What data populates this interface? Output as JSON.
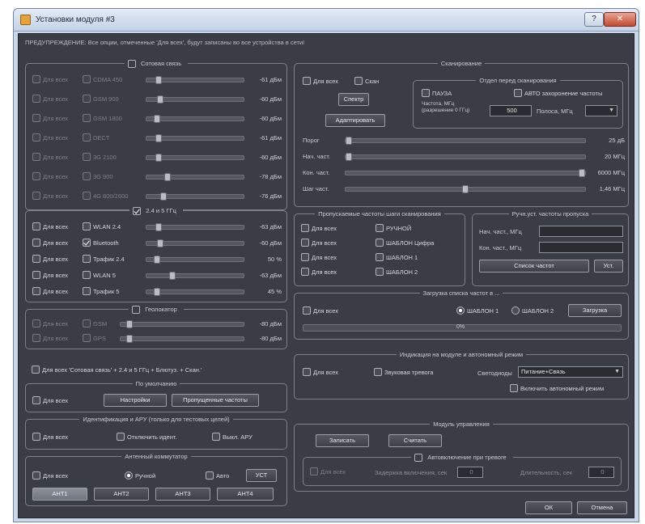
{
  "window": {
    "title": "Установки модуля #3"
  },
  "warning": "ПРЕДУПРЕЖДЕНИЕ: Все опции, отмеченные 'Для всех', будут записаны во все устройства в сети!",
  "common": {
    "for_all": "Для всех"
  },
  "cellular": {
    "title": "Сотовая связь",
    "rows": [
      {
        "name": "CDMA 450",
        "value": "-61 дБм",
        "level": 0.1
      },
      {
        "name": "GSM 900",
        "value": "-60 дБм",
        "level": 0.12
      },
      {
        "name": "GSM 1800",
        "value": "-60 дБм",
        "level": 0.08
      },
      {
        "name": "DECT",
        "value": "-61 дБм",
        "level": 0.1
      },
      {
        "name": "3G 2100",
        "value": "-60 дБм",
        "level": 0.1
      },
      {
        "name": "3G 900",
        "value": "-78 дБм",
        "level": 0.2
      },
      {
        "name": "4G 800/2600",
        "value": "-76 дБм",
        "level": 0.15
      }
    ]
  },
  "ghz": {
    "title": "2.4 и 5 ГГц",
    "rows": [
      {
        "name": "WLAN 2.4",
        "value": "-63 дБм",
        "level": 0.1,
        "checked": false
      },
      {
        "name": "Bluetooth",
        "value": "-60 дБм",
        "level": 0.12,
        "checked": true
      },
      {
        "name": "Трафик 2.4",
        "value": "50 %",
        "level": 0.08,
        "checked": false
      },
      {
        "name": "WLAN 5",
        "value": "-63 дБм",
        "level": 0.25,
        "checked": false
      },
      {
        "name": "Трафик 5",
        "value": "45 %",
        "level": 0.08,
        "checked": false
      }
    ]
  },
  "gps": {
    "title": "Геолокатор",
    "rows": [
      {
        "name": "GSM",
        "value": "-80 дБм",
        "level": 0.05
      },
      {
        "name": "GPS",
        "value": "-80 дБм",
        "level": 0.05
      }
    ]
  },
  "forall_long": "Для всех 'Сотовая связь' + 2.4 и 5 ГГц + Блютуз. + Скан.'",
  "defaults": {
    "title": "По умолчанию",
    "settings_btn": "Настройки",
    "freq_btn": "Пропущенные частоты"
  },
  "identify": {
    "title": "Идентификация и АРУ (только для тестовых целей)",
    "mute": "Отключить идент.",
    "vykl": "Выкл. АРУ"
  },
  "antenna": {
    "title": "Антенный коммутатор",
    "manual": "Ручной",
    "auto": "Авто",
    "set": "УСТ",
    "tabs": [
      "АНТ1",
      "АНТ2",
      "АНТ3",
      "АНТ4"
    ]
  },
  "scan": {
    "title": "Сканирование",
    "scan_label": "Скан",
    "spectrum": "Спектр",
    "adapt": "Адаптировать",
    "fine": {
      "title": "Отдел перед сканирования",
      "pause": "ПАУЗА",
      "auto_freq": "АВТО захоронение частоты",
      "freq_label": "Частота, МГц (разрешение 0 ГГц)",
      "band_label": "Полоса, МГц",
      "value": "500"
    },
    "rows": [
      {
        "name": "Порог",
        "value": "25 дБ",
        "level": 0.0
      },
      {
        "name": "Нач. част.",
        "value": "20 МГц",
        "level": 0.0
      },
      {
        "name": "Кон. част.",
        "value": "6000 МГц",
        "level": 1.0
      },
      {
        "name": "Шаг част.",
        "value": "1,46 МГц",
        "level": 0.5
      }
    ]
  },
  "allowed": {
    "title": "Пропускаемые частоты шаги сканирования",
    "left": [
      "Для всех",
      "Для всех",
      "Для всех",
      "Для всех"
    ],
    "right": [
      "РУЧНОЙ",
      "ШАБЛОН Цифра",
      "ШАБЛОН 1",
      "ШАБЛОН 2"
    ]
  },
  "manual": {
    "title": "Ручн.уст. частоты пропуска",
    "start": "Нач. част., МГц",
    "end": "Кон. част., МГц",
    "list_btn": "Список частот",
    "add": "Уст."
  },
  "load": {
    "title": "Загрузка списка частот в ...",
    "t1": "ШАБЛОН 1",
    "t2": "ШАБЛОН 2",
    "btn": "Загрузка",
    "progress": "0%"
  },
  "indic": {
    "title": "Индикация на модуле и автономный режим",
    "sound": "Звуковая тревога",
    "lights": "Светодиоды",
    "lights_val": "Питание+Связь",
    "auto": "Включить автономный режим"
  },
  "control": {
    "title": "Модуль управления",
    "save": "Записать",
    "read": "Считать",
    "alarm": {
      "title": "Автовключение при тревоге",
      "delay": "Задержка включения, сек",
      "dur": "Длительность, сек",
      "delay_val": "0",
      "dur_val": "0"
    }
  },
  "footer": {
    "ok": "ОК",
    "cancel": "Отмена"
  }
}
